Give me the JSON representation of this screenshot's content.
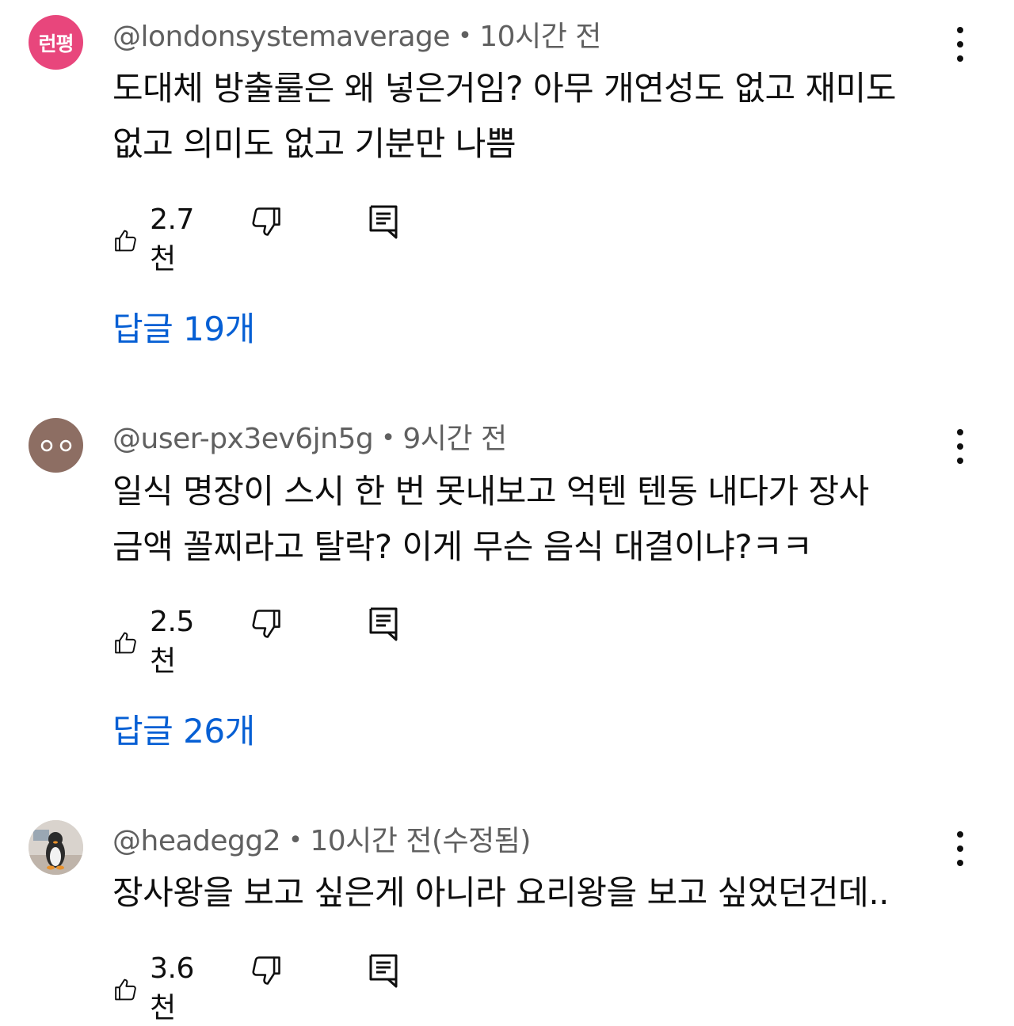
{
  "comments": [
    {
      "avatar_text": "런평",
      "avatar_color": "#e8467c",
      "handle": "@londonsystemaverage",
      "time": "10시간 전",
      "lines": [
        "도대체 방출룰은 왜 넣은거임? 아무 개연성도 없고 재미도",
        "없고 의미도 없고 기분만 나쁨"
      ],
      "likes": "2.7천",
      "replies": "답글 19개"
    },
    {
      "avatar_text": "",
      "avatar_color": "#8d6e63",
      "handle": "@user-px3ev6jn5g",
      "time": "9시간 전",
      "lines": [
        "일식 명장이 스시 한 번 못내보고 억텐 텐동 내다가 장사",
        "금액 꼴찌라고 탈락? 이게 무슨 음식 대결이냐?ㅋㅋ"
      ],
      "likes": "2.5천",
      "replies": "답글 26개"
    },
    {
      "avatar_text": "",
      "avatar_color": "#cfc9c4",
      "handle": "@headegg2",
      "time": "10시간 전(수정됨)",
      "lines": [
        "장사왕을 보고 싶은게 아니라 요리왕을 보고 싶었던건데.."
      ],
      "likes": "3.6천"
    }
  ],
  "icons": {
    "like": "thumbs-up-icon",
    "dislike": "thumbs-down-icon",
    "reply": "reply-icon",
    "menu": "more-vert-icon"
  },
  "colors": {
    "link": "#065fd4",
    "meta": "#606060",
    "text": "#0f0f0f"
  }
}
